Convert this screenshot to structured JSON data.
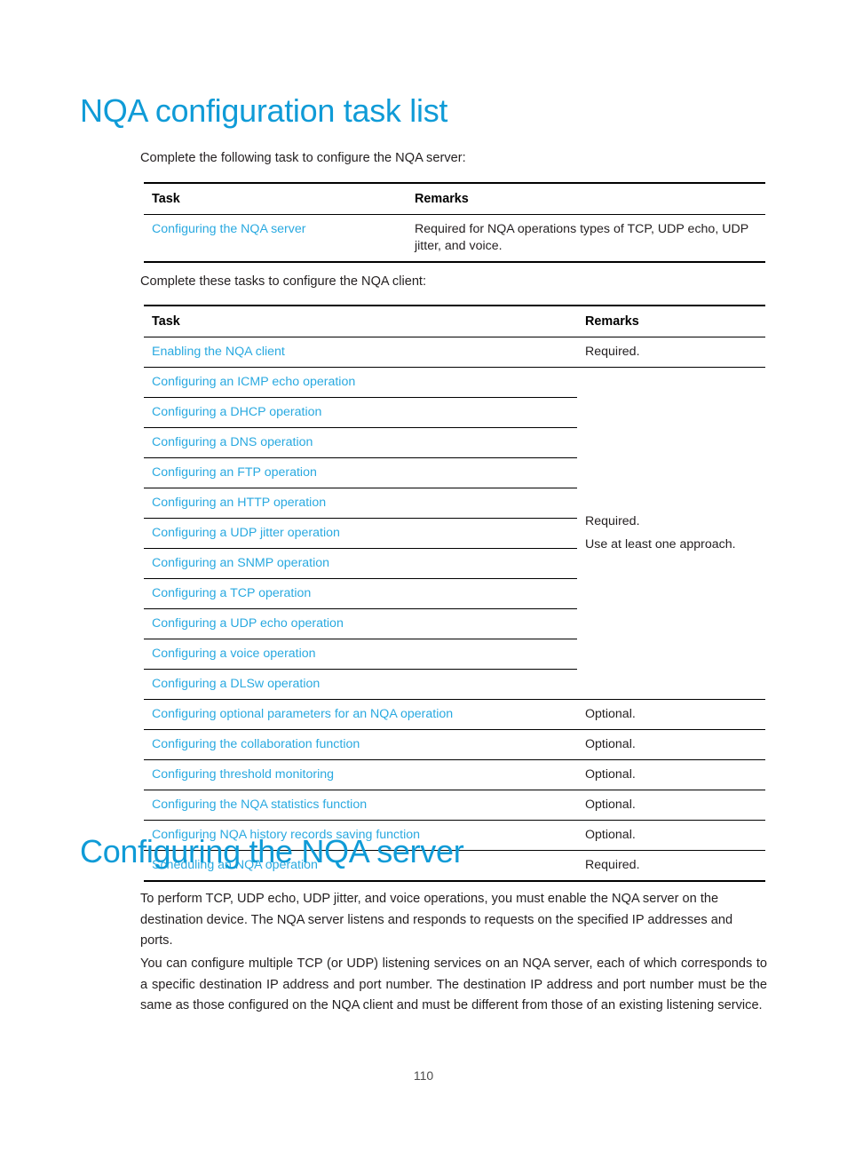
{
  "document": {
    "page_number": "110",
    "accent_heading_color": "#0f9bd7",
    "link_color": "#29a9e0",
    "text_color": "#231f20"
  },
  "section_task_list": {
    "heading": "NQA configuration task list",
    "lead_server": "Complete the following task to configure the NQA server:",
    "lead_client": "Complete these tasks to configure the NQA client:",
    "table_server": {
      "columns": [
        "Task",
        "Remarks"
      ],
      "rows": [
        {
          "task": "Configuring the NQA server",
          "remark": "Required for NQA operations types of TCP, UDP echo, UDP jitter, and voice."
        }
      ]
    },
    "table_client": {
      "columns": [
        "Task",
        "Remarks"
      ],
      "row_enabling": {
        "task": "Enabling the NQA client",
        "remark": "Required."
      },
      "merged_block": {
        "tasks": [
          "Configuring an ICMP echo operation",
          "Configuring a DHCP operation",
          "Configuring a DNS operation",
          "Configuring an FTP operation",
          "Configuring an HTTP operation",
          "Configuring a UDP jitter operation",
          "Configuring an SNMP operation",
          "Configuring a TCP operation",
          "Configuring a UDP echo operation",
          "Configuring a voice operation",
          "Configuring a DLSw operation"
        ],
        "remark_line1": "Required.",
        "remark_line2": "Use at least one approach."
      },
      "trailing_rows": [
        {
          "task": "Configuring optional parameters for an NQA operation",
          "remark": "Optional."
        },
        {
          "task": "Configuring the collaboration function",
          "remark": "Optional."
        },
        {
          "task": "Configuring threshold monitoring",
          "remark": "Optional."
        },
        {
          "task": "Configuring the NQA statistics function",
          "remark": "Optional."
        },
        {
          "task": "Configuring NQA history records saving function",
          "remark": "Optional."
        },
        {
          "task": "Scheduling an NQA operation",
          "remark": "Required."
        }
      ]
    }
  },
  "section_configuring_server": {
    "heading": "Configuring the NQA server",
    "paragraph1": "To perform TCP, UDP echo, UDP jitter, and voice operations, you must enable the NQA server on the destination device. The NQA server listens and responds to requests on the specified IP addresses and ports.",
    "paragraph2": "You can configure multiple TCP (or UDP) listening services on an NQA server, each of which corresponds to a specific destination IP address and port number. The destination IP address and port number must be the same as those configured on the NQA client and must be different from those of an existing listening service."
  }
}
